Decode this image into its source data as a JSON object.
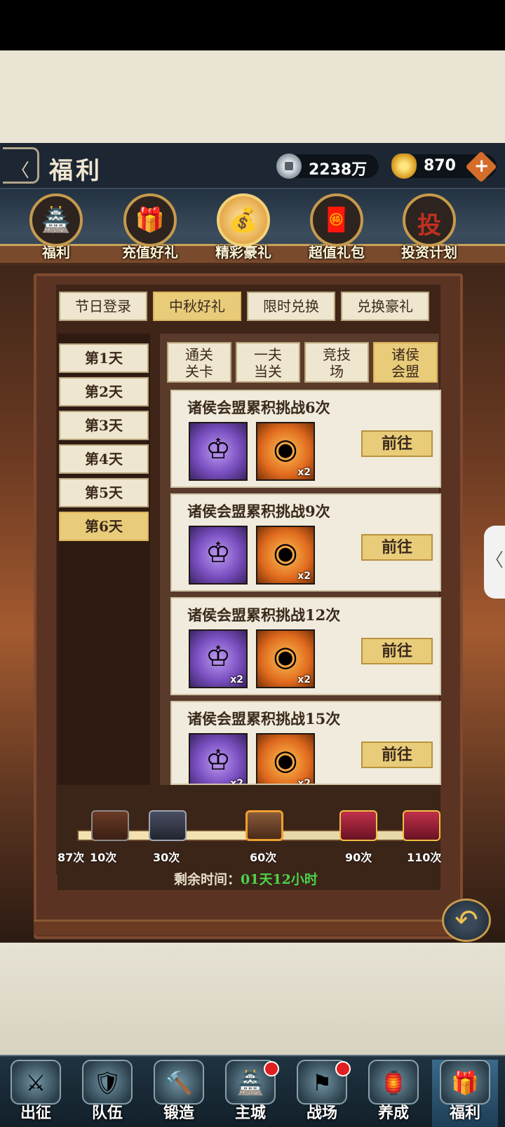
{
  "header": {
    "title": "福利",
    "coins": "2238万",
    "gold": "870",
    "plus_icon": "+",
    "back_icon": "〈"
  },
  "categories": [
    {
      "label": "福利",
      "icon": "🏯"
    },
    {
      "label": "充值好礼",
      "icon": "🎁"
    },
    {
      "label": "精彩豪礼",
      "icon": "💰"
    },
    {
      "label": "超值礼包",
      "icon": "🧧"
    },
    {
      "label": "投资计划",
      "icon": "投"
    }
  ],
  "tabs": [
    "节日登录",
    "中秋好礼",
    "限时兑换",
    "兑换豪礼"
  ],
  "days": [
    "第1天",
    "第2天",
    "第3天",
    "第4天",
    "第5天",
    "第6天"
  ],
  "subtabs": [
    "通关\n关卡",
    "一夫\n当关",
    "竞技\n场",
    "诸侯\n会盟"
  ],
  "tasks": [
    {
      "title": "诸侯会盟累积挑战6次",
      "item1_count": "",
      "item2_count": "x2",
      "button": "前往"
    },
    {
      "title": "诸侯会盟累积挑战9次",
      "item1_count": "",
      "item2_count": "x2",
      "button": "前往"
    },
    {
      "title": "诸侯会盟累积挑战12次",
      "item1_count": "x2",
      "item2_count": "x2",
      "button": "前往"
    },
    {
      "title": "诸侯会盟累积挑战15次",
      "item1_count": "x2",
      "item2_count": "x2",
      "button": "前往"
    }
  ],
  "progress": {
    "current_label": "87次",
    "fraction": 0.5,
    "milestones": [
      "10次",
      "30次",
      "60次",
      "90次",
      "110次"
    ]
  },
  "timer": {
    "label": "剩余时间：",
    "value": "01天12小时"
  },
  "return_icon": "↶",
  "side_handle_icon": "〈",
  "nav": [
    {
      "label": "出征",
      "icon": "⚔",
      "badge": false
    },
    {
      "label": "队伍",
      "icon": "🛡",
      "badge": false
    },
    {
      "label": "锻造",
      "icon": "🔨",
      "badge": false
    },
    {
      "label": "主城",
      "icon": "🏯",
      "badge": true
    },
    {
      "label": "战场",
      "icon": "⚑",
      "badge": true
    },
    {
      "label": "养成",
      "icon": "🏮",
      "badge": false
    },
    {
      "label": "福利",
      "icon": "🎁",
      "badge": false
    }
  ]
}
